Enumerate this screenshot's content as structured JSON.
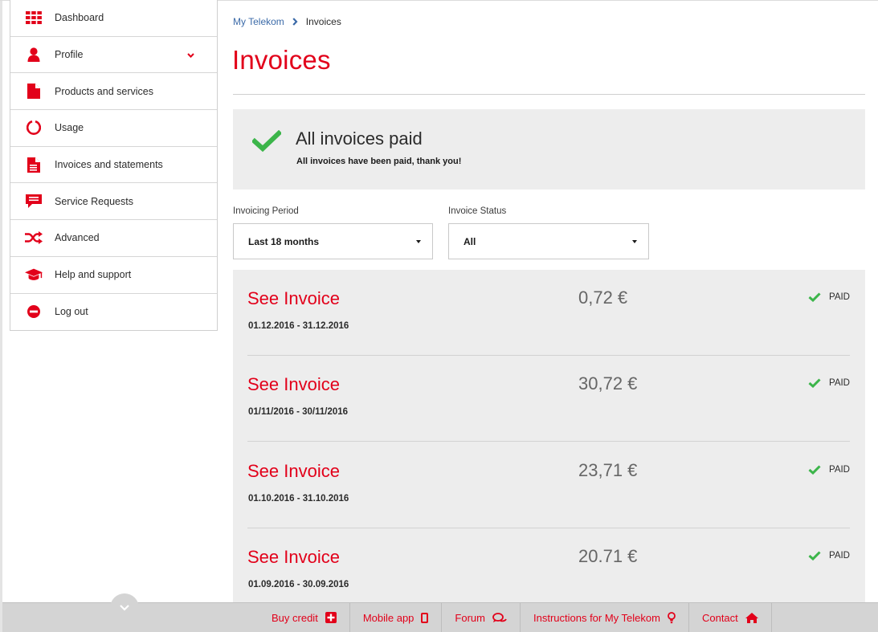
{
  "sidebar": {
    "items": [
      {
        "label": "Dashboard",
        "icon": "grid-icon"
      },
      {
        "label": "Profile",
        "icon": "user-icon"
      },
      {
        "label": "Products and services",
        "icon": "document-icon"
      },
      {
        "label": "Usage",
        "icon": "usage-ring-icon"
      },
      {
        "label": "Invoices and statements",
        "icon": "invoice-document-icon"
      },
      {
        "label": "Service Requests",
        "icon": "chat-bubble-icon"
      },
      {
        "label": "Advanced",
        "icon": "shuffle-icon"
      },
      {
        "label": "Help and support",
        "icon": "graduation-cap-icon"
      },
      {
        "label": "Log out",
        "icon": "minus-circle-icon"
      }
    ]
  },
  "breadcrumb": {
    "home": "My Telekom",
    "current": "Invoices"
  },
  "page": {
    "title": "Invoices"
  },
  "status": {
    "heading": "All invoices paid",
    "text": "All invoices have been paid, thank you!"
  },
  "filters": {
    "period": {
      "label": "Invoicing Period",
      "value": "Last 18 months"
    },
    "status": {
      "label": "Invoice Status",
      "value": "All"
    }
  },
  "invoices": [
    {
      "link": "See Invoice",
      "dates": "01.12.2016 - 31.12.2016",
      "amount": "0,72 €",
      "status": "PAID"
    },
    {
      "link": "See Invoice",
      "dates": "01/11/2016 - 30/11/2016",
      "amount": "30,72 €",
      "status": "PAID"
    },
    {
      "link": "See Invoice",
      "dates": "01.10.2016 - 31.10.2016",
      "amount": "23,71 €",
      "status": "PAID"
    },
    {
      "link": "See Invoice",
      "dates": "01.09.2016 - 30.09.2016",
      "amount": "20.71 €",
      "status": "PAID"
    }
  ],
  "footer": {
    "links": [
      {
        "label": "Buy credit",
        "icon": "plus-box-icon"
      },
      {
        "label": "Mobile app",
        "icon": "phone-icon"
      },
      {
        "label": "Forum",
        "icon": "chat-icon"
      },
      {
        "label": "Instructions for My Telekom",
        "icon": "lightbulb-icon"
      },
      {
        "label": "Contact",
        "icon": "home-icon"
      }
    ]
  },
  "colors": {
    "brand": "#e2001a",
    "paid": "#3cb54a",
    "panel": "#ededed",
    "link": "#3b6aa8"
  }
}
